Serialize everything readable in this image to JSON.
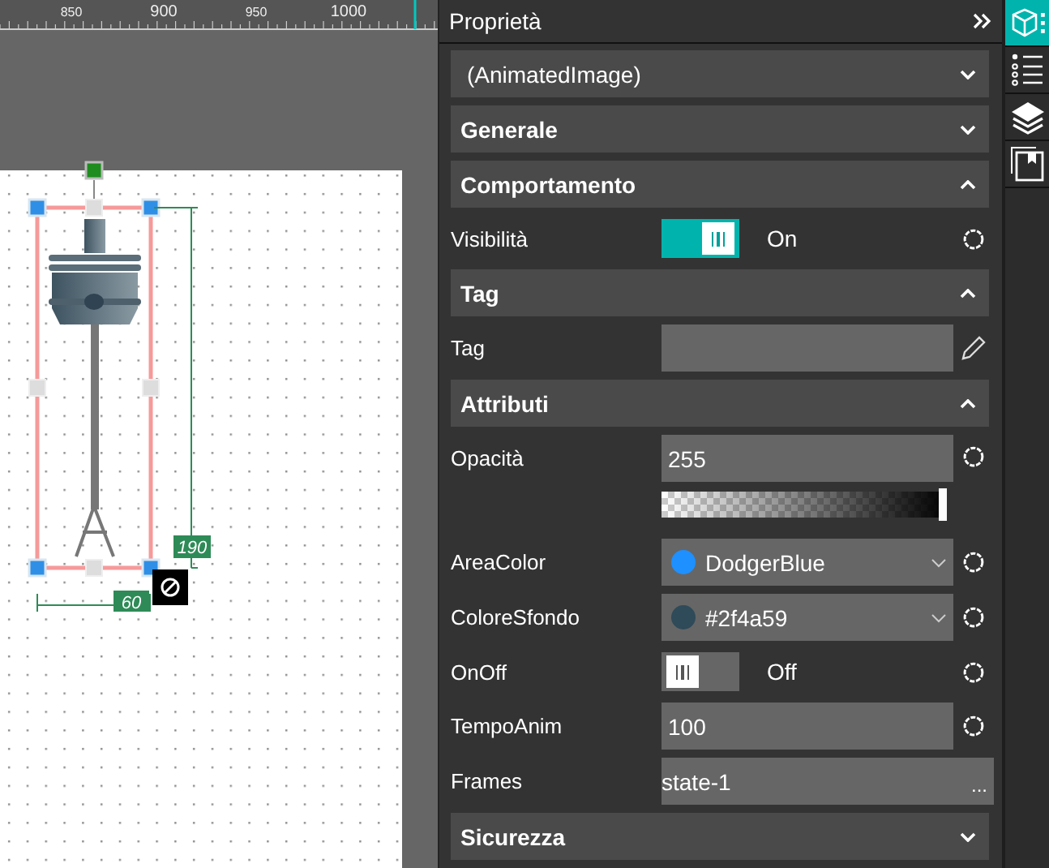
{
  "ruler": {
    "ticks": [
      {
        "label": "850"
      },
      {
        "label": "900"
      },
      {
        "label": "950"
      },
      {
        "label": "1000"
      }
    ]
  },
  "canvas": {
    "width_label": "60",
    "height_label": "190"
  },
  "panel": {
    "title": "Proprietà",
    "items": [
      {
        "kind": "dropdown",
        "label": "(AnimatedImage)"
      },
      {
        "kind": "section",
        "label": "Generale",
        "expanded": false
      },
      {
        "kind": "section",
        "label": "Comportamento",
        "expanded": true
      },
      {
        "kind": "toggle",
        "label": "Visibilità",
        "on": true,
        "state": "On"
      },
      {
        "kind": "section",
        "label": "Tag",
        "expanded": true
      },
      {
        "kind": "tag",
        "label": "Tag"
      },
      {
        "kind": "section",
        "label": "Attributi",
        "expanded": true
      },
      {
        "kind": "opacity",
        "label": "Opacità",
        "value": "255",
        "level": 1
      },
      {
        "kind": "color",
        "label": "AreaColor",
        "value": "DodgerBlue",
        "color": "#1e90ff"
      },
      {
        "kind": "color",
        "label": "ColoreSfondo",
        "value": "#2f4a59",
        "color": "#2f4a59"
      },
      {
        "kind": "toggle",
        "label": "OnOff",
        "on": false,
        "state": "Off"
      },
      {
        "kind": "text",
        "label": "TempoAnim",
        "value": "100"
      },
      {
        "kind": "frames",
        "label": "Frames",
        "value": "state-1",
        "button": "..."
      },
      {
        "kind": "section",
        "label": "Sicurezza",
        "expanded": false
      }
    ]
  },
  "side_tabs": [
    {
      "selected": true
    },
    {
      "selected": false
    },
    {
      "selected": false
    },
    {
      "selected": false
    }
  ]
}
